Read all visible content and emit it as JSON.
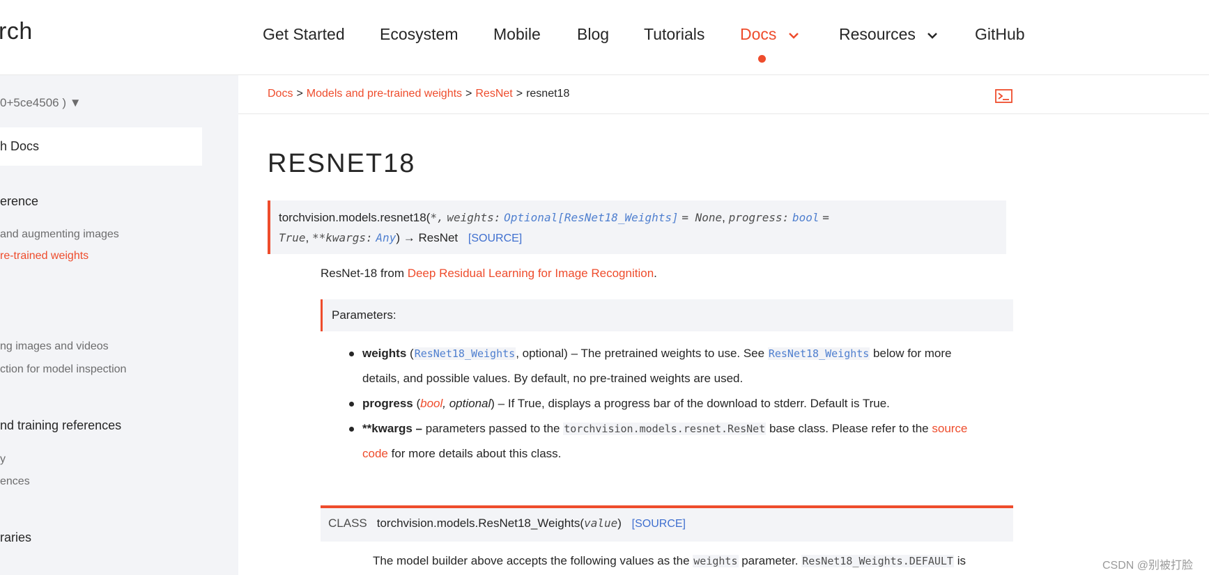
{
  "header": {
    "logo_text": "rch",
    "nav": [
      {
        "label": "Get Started"
      },
      {
        "label": "Ecosystem"
      },
      {
        "label": "Mobile"
      },
      {
        "label": "Blog"
      },
      {
        "label": "Tutorials"
      },
      {
        "label": "Docs",
        "active": true
      },
      {
        "label": "Resources"
      },
      {
        "label": "GitHub"
      }
    ]
  },
  "sidebar": {
    "version": "0+5ce4506 ) ▼",
    "search_value": "h Docs",
    "sections": [
      {
        "label": "erence"
      },
      {
        "label": "and augmenting images"
      },
      {
        "label": "re-trained weights",
        "current": true
      },
      {
        "label": "ng images and videos"
      },
      {
        "label": "ction for model inspection"
      },
      {
        "label": "nd training references"
      },
      {
        "label": "y"
      },
      {
        "label": "ences"
      },
      {
        "label": "raries"
      }
    ]
  },
  "breadcrumb": {
    "items": [
      "Docs",
      "Models and pre-trained weights",
      "ResNet"
    ],
    "separator": ">",
    "current": "resnet18"
  },
  "page": {
    "title": "RESNET18",
    "signature": {
      "prefix": "torchvision.models.resnet18",
      "open": "(",
      "star": "*,",
      "p1": "weights:",
      "p1_type_a": "Optional[",
      "p1_type_b": "ResNet18_Weights",
      "p1_type_c": "]",
      "p1_default": "= None",
      "p2": "progress:",
      "p2_type": "bool",
      "p2_eq": "=",
      "p2_default": "True",
      "p3": "**kwargs:",
      "p3_type": "Any",
      "close": ")",
      "returns": "→ ResNet",
      "source": "[SOURCE]"
    },
    "description": {
      "prefix": "ResNet-18 from ",
      "link": "Deep Residual Learning for Image Recognition",
      "suffix": "."
    },
    "params_heading": "Parameters:",
    "params": {
      "weights": {
        "name": "weights",
        "open": " (",
        "type": "ResNet18_Weights",
        "opt": ", optional) – The pretrained weights to use. See ",
        "ref": "ResNet18_Weights",
        "rest": " below for more details, and possible values. By default, no pre-trained weights are used."
      },
      "progress": {
        "name": "progress",
        "open": " (",
        "type": "bool",
        "opt": ", optional",
        "rest": ") – If True, displays a progress bar of the download to stderr. Default is True."
      },
      "kwargs": {
        "name": "**kwargs",
        "dash": " – ",
        "pre": "parameters passed to the ",
        "code": "torchvision.models.resnet.ResNet",
        "mid": " base class. Please refer to the ",
        "link": "source code",
        "rest": " for more details about this class."
      }
    },
    "class_block": {
      "keyword": "CLASS",
      "name": "torchvision.models.ResNet18_Weights",
      "open": "(",
      "param": "value",
      "close": ")",
      "source": "[SOURCE]"
    },
    "tail": {
      "pre": "The model builder above accepts the following values as the ",
      "code1": "weights",
      "mid": " parameter. ",
      "code2": "ResNet18_Weights.DEFAULT",
      "post": " is"
    }
  },
  "watermark": "CSDN @别被打脸",
  "colors": {
    "accent": "#ee4c2c",
    "code_blue": "#4f7fcf",
    "panel": "#f3f4f7"
  }
}
